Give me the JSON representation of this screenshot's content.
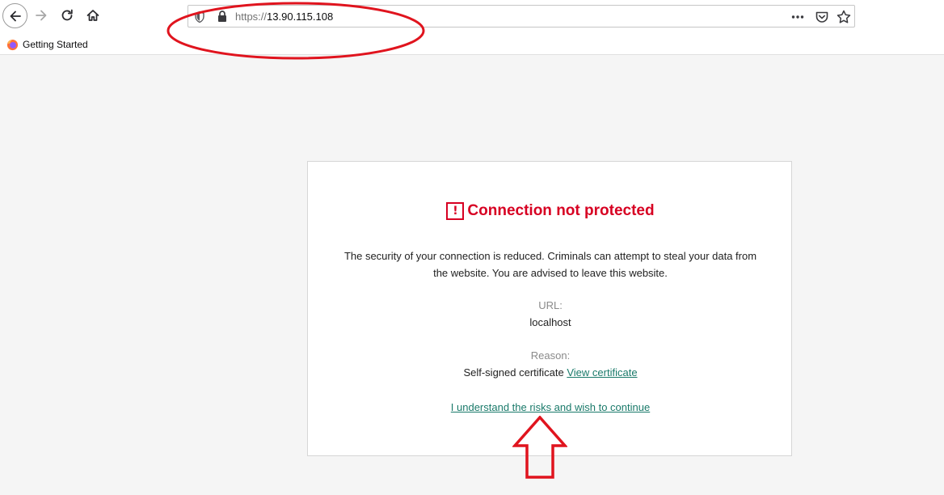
{
  "browser": {
    "url_scheme": "https://",
    "url_host": "13.90.115.108",
    "bookmarks": [
      {
        "label": "Getting Started",
        "icon": "firefox-icon"
      }
    ]
  },
  "page": {
    "title": "Connection not protected",
    "warning_icon_glyph": "!",
    "description": "The security of your connection is reduced. Criminals can attempt to steal your data from the website. You are advised to leave this website.",
    "url_label": "URL:",
    "url_value": "localhost",
    "reason_label": "Reason:",
    "reason_value": "Self-signed certificate",
    "view_certificate_link": "View certificate",
    "continue_link": "I understand the risks and wish to continue"
  },
  "colors": {
    "error_red": "#d70022",
    "link_teal": "#1a7a6a",
    "annotation_red": "#e0141e",
    "page_bg": "#f5f5f5"
  }
}
